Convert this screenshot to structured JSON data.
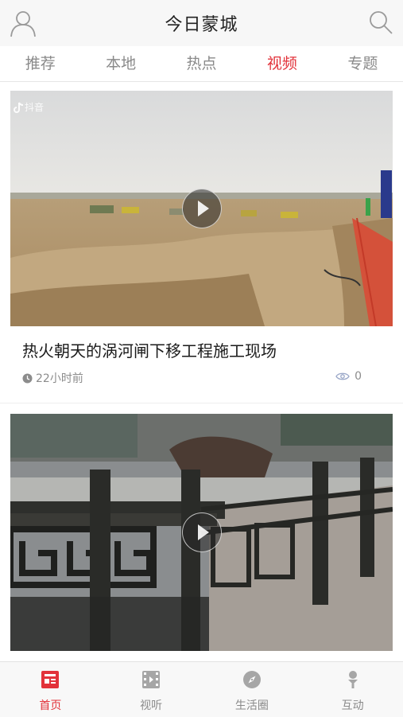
{
  "header": {
    "title": "今日蒙城",
    "avatar_icon": "user-icon",
    "search_icon": "search-icon"
  },
  "tabs": [
    {
      "label": "推荐",
      "active": false
    },
    {
      "label": "本地",
      "active": false
    },
    {
      "label": "热点",
      "active": false
    },
    {
      "label": "视频",
      "active": true
    },
    {
      "label": "专题",
      "active": false
    }
  ],
  "feed": [
    {
      "title": "热火朝天的涡河闸下移工程施工现场",
      "time": "22小时前",
      "views": "0",
      "watermark": "抖音"
    },
    {
      "title": ""
    }
  ],
  "bottom_nav": [
    {
      "label": "首页",
      "icon": "news-icon",
      "active": true
    },
    {
      "label": "视听",
      "icon": "film-icon",
      "active": false
    },
    {
      "label": "生活圈",
      "icon": "compass-icon",
      "active": false
    },
    {
      "label": "互动",
      "icon": "microphone-icon",
      "active": false
    }
  ],
  "colors": {
    "accent": "#e2323a",
    "inactive": "#8a8a8a"
  }
}
